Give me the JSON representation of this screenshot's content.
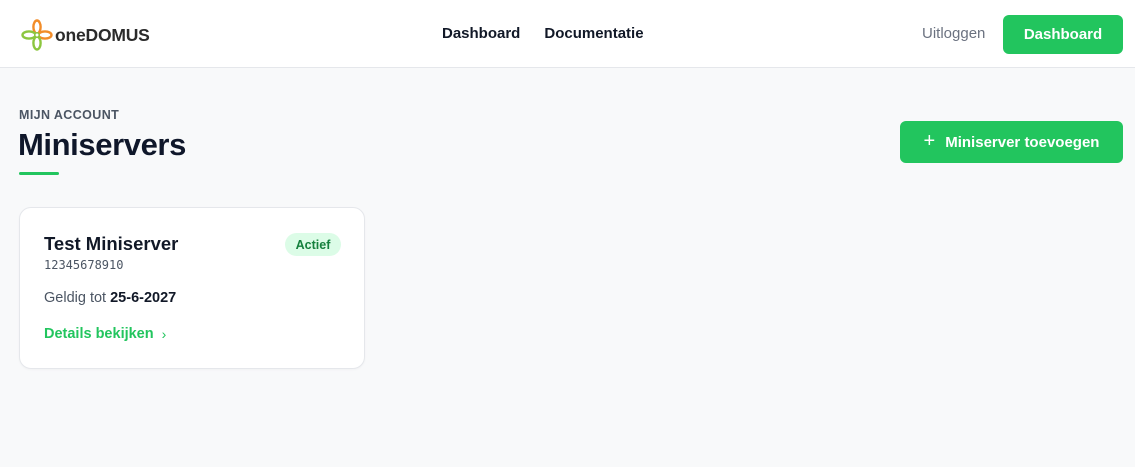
{
  "brand": {
    "name": "oneDOMUS"
  },
  "colors": {
    "accent": "#22c55e",
    "badge_bg": "#dcfce7",
    "badge_text": "#15803d"
  },
  "nav": {
    "items": [
      "Dashboard",
      "Documentatie"
    ]
  },
  "header": {
    "logout_label": "Uitloggen",
    "dashboard_button": "Dashboard"
  },
  "page": {
    "eyebrow": "MIJN ACCOUNT",
    "title": "Miniservers",
    "add_button": "Miniserver toevoegen",
    "add_icon": "plus-icon"
  },
  "miniservers": [
    {
      "name": "Test Miniserver",
      "serial": "12345678910",
      "status": "Actief",
      "valid_label": "Geldig tot",
      "valid_until": "25-6-2027",
      "details_label": "Details bekijken",
      "details_icon": "chevron-right-icon"
    }
  ]
}
